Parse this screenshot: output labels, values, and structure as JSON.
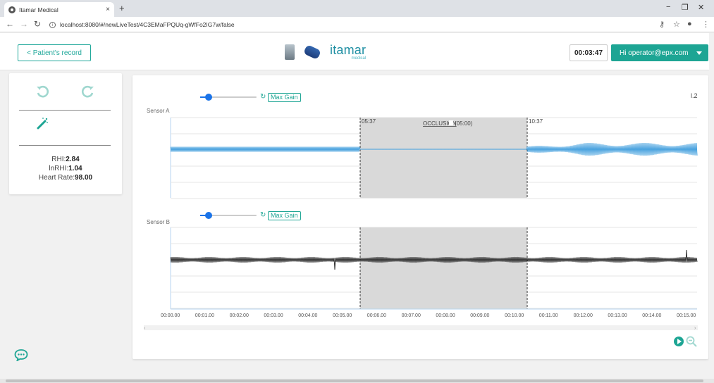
{
  "browser": {
    "tab_title": "Itamar Medical",
    "tab_close": "×",
    "new_tab": "+",
    "url": "localhost:8080/#/newLiveTest/4C3EMaFPQUq-gWfFo2IG7w/false",
    "minimize": "−",
    "restore": "❐",
    "close": "✕"
  },
  "header": {
    "back_label": "< Patient's record",
    "brand_name": "itamar",
    "brand_sub": "medical",
    "timer": "00:03:47",
    "user_label": "Hi operator@epx.com"
  },
  "left_panel": {
    "rhi_label": "RHI:",
    "rhi_value": "2.84",
    "lnrhi_label": "lnRHI:",
    "lnrhi_value": "1.04",
    "hr_label": "Heart Rate:",
    "hr_value": "98.00"
  },
  "graph": {
    "version": "l.2",
    "max_gain_label": "Max Gain",
    "sensor_a_label": "Sensor A",
    "sensor_b_label": "Sensor B",
    "occlusion_start": "05:37",
    "occlusion_end": "10:37",
    "occlusion_label": "OCCLUSION",
    "occlusion_duration": "(05:00)",
    "x_ticks": [
      "00:00.00",
      "00:01.00",
      "00:02.00",
      "00:03.00",
      "00:04.00",
      "00:05.00",
      "00:06.00",
      "00:07.00",
      "00:08.00",
      "00:09.00",
      "00:10.00",
      "00:11.00",
      "00:12.00",
      "00:13.00",
      "00:14.00",
      "00:15.00"
    ]
  },
  "colors": {
    "accent": "#1da594",
    "sensor_a": "#4aa3df",
    "sensor_b": "#333333",
    "occlusion_fill": "#d9d9d9"
  }
}
